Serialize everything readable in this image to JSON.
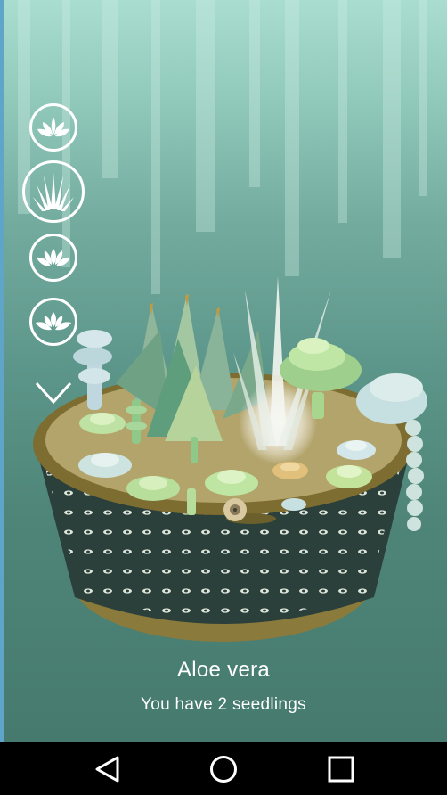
{
  "garden": {
    "plant_name": "Aloe vera",
    "seedlings_text": "You have 2 seedlings"
  },
  "tools": [
    {
      "icon": "succulent-rosette-icon",
      "selected": false
    },
    {
      "icon": "aloe-vera-icon",
      "selected": true
    },
    {
      "icon": "lotus-succulent-icon",
      "selected": false
    },
    {
      "icon": "echeveria-icon",
      "selected": false
    }
  ],
  "nav": {
    "back_icon": "back-triangle-icon",
    "home_icon": "home-circle-icon",
    "recents_icon": "recents-square-icon"
  },
  "colors": {
    "sky_top": "#a9ddd0",
    "sky_bottom": "#467a6e",
    "pot": "#2b3f3b",
    "soil": "#b3a46b",
    "rim": "#8a7a3b",
    "succulent_light": "#bfe6a4",
    "succulent_dark": "#5e9e7c"
  }
}
